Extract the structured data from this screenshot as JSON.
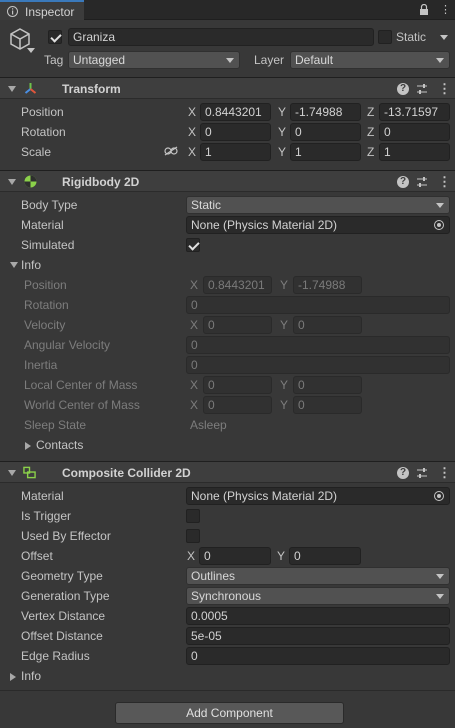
{
  "tab": {
    "title": "Inspector"
  },
  "object": {
    "name": "Graniza",
    "static_label": "Static",
    "tag_label": "Tag",
    "tag_value": "Untagged",
    "layer_label": "Layer",
    "layer_value": "Default"
  },
  "transform": {
    "title": "Transform",
    "rows": [
      {
        "label": "Position",
        "x": "0.8443201",
        "y": "-1.74988",
        "z": "-13.71597"
      },
      {
        "label": "Rotation",
        "x": "0",
        "y": "0",
        "z": "0"
      },
      {
        "label": "Scale",
        "x": "1",
        "y": "1",
        "z": "1"
      }
    ],
    "axes": [
      "X",
      "Y",
      "Z"
    ]
  },
  "rigidbody": {
    "title": "Rigidbody 2D",
    "body_type_label": "Body Type",
    "body_type_value": "Static",
    "material_label": "Material",
    "material_value": "None (Physics Material 2D)",
    "simulated_label": "Simulated",
    "info_label": "Info",
    "info": {
      "position_label": "Position",
      "position_x": "0.8443201",
      "position_y": "-1.74988",
      "rotation_label": "Rotation",
      "rotation_value": "0",
      "velocity_label": "Velocity",
      "velocity_x": "0",
      "velocity_y": "0",
      "angular_velocity_label": "Angular Velocity",
      "angular_velocity_value": "0",
      "inertia_label": "Inertia",
      "inertia_value": "0",
      "local_com_label": "Local Center of Mass",
      "local_com_x": "0",
      "local_com_y": "0",
      "world_com_label": "World Center of Mass",
      "world_com_x": "0",
      "world_com_y": "0",
      "sleep_state_label": "Sleep State",
      "sleep_state_value": "Asleep",
      "contacts_label": "Contacts"
    }
  },
  "composite": {
    "title": "Composite Collider 2D",
    "material_label": "Material",
    "material_value": "None (Physics Material 2D)",
    "is_trigger_label": "Is Trigger",
    "used_by_effector_label": "Used By Effector",
    "offset_label": "Offset",
    "offset_x": "0",
    "offset_y": "0",
    "geometry_type_label": "Geometry Type",
    "geometry_type_value": "Outlines",
    "generation_type_label": "Generation Type",
    "generation_type_value": "Synchronous",
    "vertex_distance_label": "Vertex Distance",
    "vertex_distance_value": "0.0005",
    "offset_distance_label": "Offset Distance",
    "offset_distance_value": "5e-05",
    "edge_radius_label": "Edge Radius",
    "edge_radius_value": "0",
    "info_label": "Info"
  },
  "add_component_label": "Add Component",
  "axis_x": "X",
  "axis_y": "Y",
  "axis_z": "Z"
}
